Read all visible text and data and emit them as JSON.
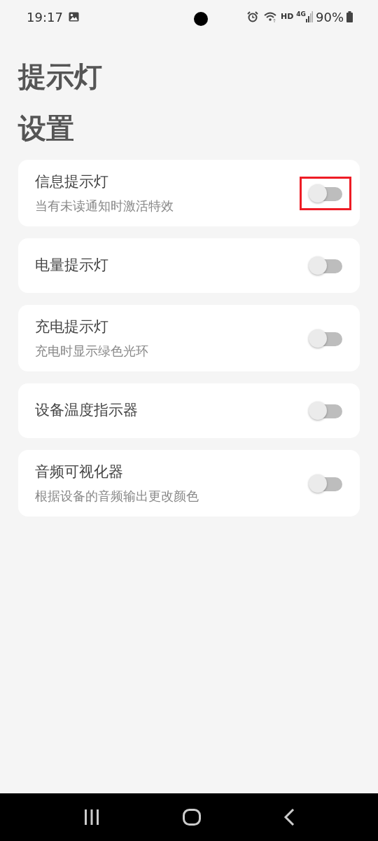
{
  "status_bar": {
    "time": "19:17",
    "network_label": "HD",
    "network_type": "4G",
    "battery": "90%"
  },
  "title_lines": [
    "提示灯",
    "设置"
  ],
  "settings": [
    {
      "title": "信息提示灯",
      "subtitle": "当有未读通知时激活特效",
      "on": false,
      "highlighted": true
    },
    {
      "title": "电量提示灯",
      "on": false,
      "highlighted": false
    },
    {
      "title": "充电提示灯",
      "subtitle": "充电时显示绿色光环",
      "on": false,
      "highlighted": false
    },
    {
      "title": "设备温度指示器",
      "on": false,
      "highlighted": false
    },
    {
      "title": "音频可视化器",
      "subtitle": "根据设备的音频输出更改颜色",
      "on": false,
      "highlighted": false
    }
  ]
}
